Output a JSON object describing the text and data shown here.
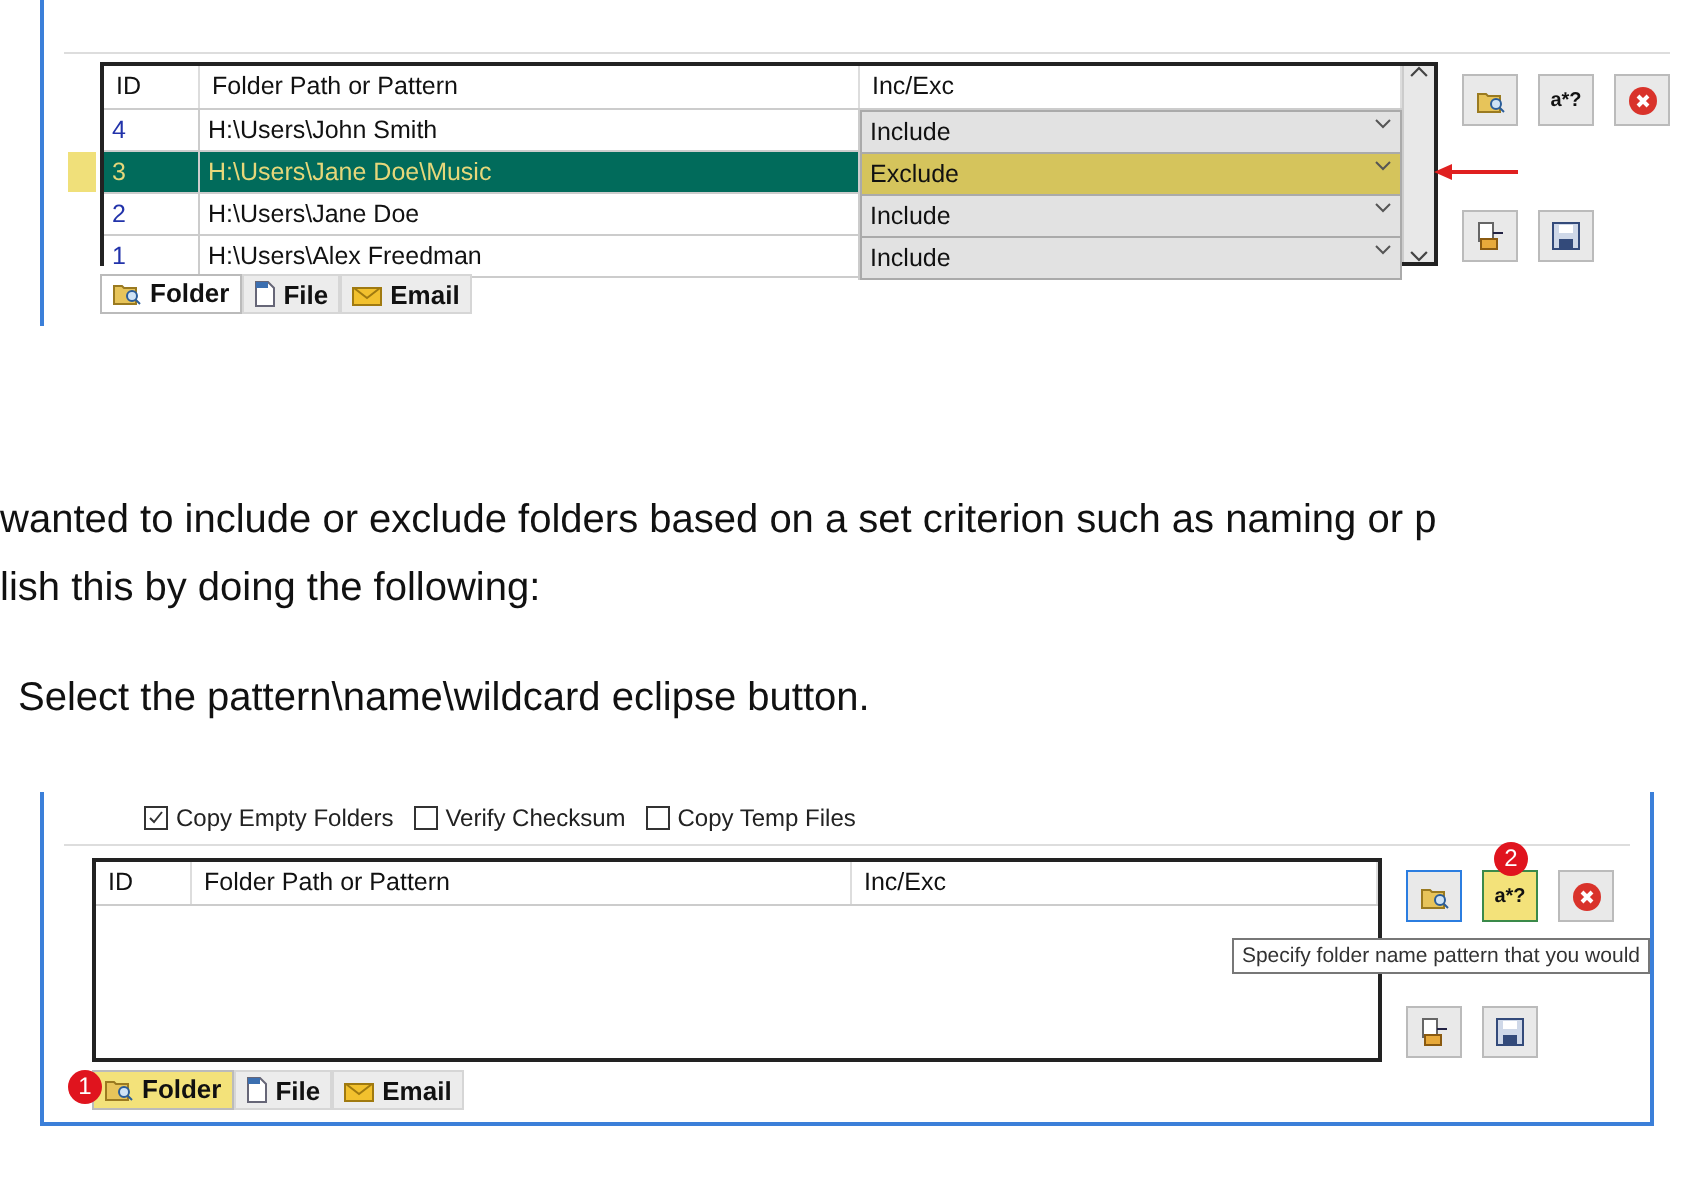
{
  "screenshots": [
    {
      "columns": [
        "ID",
        "Folder Path or Pattern",
        "Inc/Exc"
      ],
      "rows": [
        {
          "id": "4",
          "path": "H:\\Users\\John Smith",
          "mode": "Include",
          "selected": false
        },
        {
          "id": "3",
          "path": "H:\\Users\\Jane Doe\\Music",
          "mode": "Exclude",
          "selected": true
        },
        {
          "id": "2",
          "path": "H:\\Users\\Jane Doe",
          "mode": "Include",
          "selected": false
        },
        {
          "id": "1",
          "path": "H:\\Users\\Alex Freedman",
          "mode": "Include",
          "selected": false
        }
      ],
      "row_annotation": true,
      "buttons": [
        {
          "kind": "folder-search",
          "highlighted": false,
          "focused": false
        },
        {
          "kind": "pattern",
          "label": "a*?",
          "highlighted": false,
          "focused": false
        },
        {
          "kind": "delete",
          "highlighted": false,
          "focused": false
        },
        {
          "kind": "import",
          "highlighted": false,
          "focused": false
        },
        {
          "kind": "save",
          "highlighted": false,
          "focused": false
        }
      ],
      "tabs": [
        {
          "label": "Folder",
          "kind": "folder",
          "selected": true,
          "highlighted": false
        },
        {
          "label": "File",
          "kind": "file",
          "selected": false,
          "highlighted": false
        },
        {
          "label": "Email",
          "kind": "email",
          "selected": false,
          "highlighted": false
        }
      ]
    },
    {
      "checkboxes": [
        {
          "label": "Copy Empty Folders",
          "checked": true
        },
        {
          "label": "Verify Checksum",
          "checked": false
        },
        {
          "label": "Copy Temp Files",
          "checked": false
        }
      ],
      "columns": [
        "ID",
        "Folder Path or Pattern",
        "Inc/Exc"
      ],
      "row_annotation": false,
      "buttons": [
        {
          "kind": "folder-search",
          "highlighted": false,
          "focused": true
        },
        {
          "kind": "pattern",
          "label": "a*?",
          "highlighted": true,
          "focused": false,
          "badge": "2"
        },
        {
          "kind": "delete",
          "highlighted": false,
          "focused": false
        },
        {
          "kind": "import",
          "highlighted": false,
          "focused": false
        },
        {
          "kind": "save",
          "highlighted": false,
          "focused": false
        }
      ],
      "tooltip": "Specify folder name pattern that you would",
      "tabs": [
        {
          "label": "Folder",
          "kind": "folder",
          "selected": true,
          "highlighted": true,
          "badge": "1"
        },
        {
          "label": "File",
          "kind": "file",
          "selected": false,
          "highlighted": false
        },
        {
          "label": "Email",
          "kind": "email",
          "selected": false,
          "highlighted": false
        }
      ]
    }
  ],
  "paragraph_lines": [
    "wanted to include or exclude folders based on a set criterion such as naming or p",
    "lish this by doing the following:"
  ],
  "step": "Select the pattern\\name\\wildcard eclipse button."
}
